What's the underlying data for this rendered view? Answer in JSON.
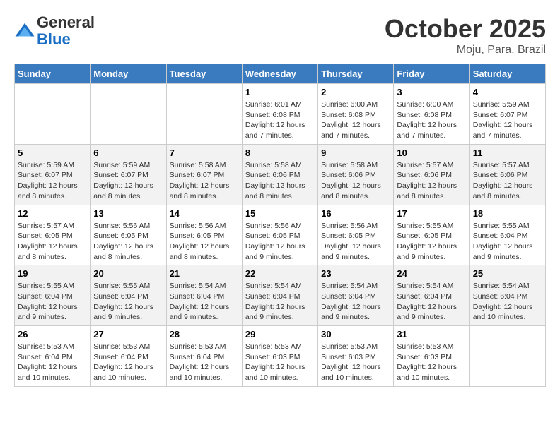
{
  "header": {
    "logo_line1": "General",
    "logo_line2": "Blue",
    "month_title": "October 2025",
    "location": "Moju, Para, Brazil"
  },
  "days_of_week": [
    "Sunday",
    "Monday",
    "Tuesday",
    "Wednesday",
    "Thursday",
    "Friday",
    "Saturday"
  ],
  "weeks": [
    [
      {
        "day": "",
        "info": ""
      },
      {
        "day": "",
        "info": ""
      },
      {
        "day": "",
        "info": ""
      },
      {
        "day": "1",
        "info": "Sunrise: 6:01 AM\nSunset: 6:08 PM\nDaylight: 12 hours and 7 minutes."
      },
      {
        "day": "2",
        "info": "Sunrise: 6:00 AM\nSunset: 6:08 PM\nDaylight: 12 hours and 7 minutes."
      },
      {
        "day": "3",
        "info": "Sunrise: 6:00 AM\nSunset: 6:08 PM\nDaylight: 12 hours and 7 minutes."
      },
      {
        "day": "4",
        "info": "Sunrise: 5:59 AM\nSunset: 6:07 PM\nDaylight: 12 hours and 7 minutes."
      }
    ],
    [
      {
        "day": "5",
        "info": "Sunrise: 5:59 AM\nSunset: 6:07 PM\nDaylight: 12 hours and 8 minutes."
      },
      {
        "day": "6",
        "info": "Sunrise: 5:59 AM\nSunset: 6:07 PM\nDaylight: 12 hours and 8 minutes."
      },
      {
        "day": "7",
        "info": "Sunrise: 5:58 AM\nSunset: 6:07 PM\nDaylight: 12 hours and 8 minutes."
      },
      {
        "day": "8",
        "info": "Sunrise: 5:58 AM\nSunset: 6:06 PM\nDaylight: 12 hours and 8 minutes."
      },
      {
        "day": "9",
        "info": "Sunrise: 5:58 AM\nSunset: 6:06 PM\nDaylight: 12 hours and 8 minutes."
      },
      {
        "day": "10",
        "info": "Sunrise: 5:57 AM\nSunset: 6:06 PM\nDaylight: 12 hours and 8 minutes."
      },
      {
        "day": "11",
        "info": "Sunrise: 5:57 AM\nSunset: 6:06 PM\nDaylight: 12 hours and 8 minutes."
      }
    ],
    [
      {
        "day": "12",
        "info": "Sunrise: 5:57 AM\nSunset: 6:05 PM\nDaylight: 12 hours and 8 minutes."
      },
      {
        "day": "13",
        "info": "Sunrise: 5:56 AM\nSunset: 6:05 PM\nDaylight: 12 hours and 8 minutes."
      },
      {
        "day": "14",
        "info": "Sunrise: 5:56 AM\nSunset: 6:05 PM\nDaylight: 12 hours and 8 minutes."
      },
      {
        "day": "15",
        "info": "Sunrise: 5:56 AM\nSunset: 6:05 PM\nDaylight: 12 hours and 9 minutes."
      },
      {
        "day": "16",
        "info": "Sunrise: 5:56 AM\nSunset: 6:05 PM\nDaylight: 12 hours and 9 minutes."
      },
      {
        "day": "17",
        "info": "Sunrise: 5:55 AM\nSunset: 6:05 PM\nDaylight: 12 hours and 9 minutes."
      },
      {
        "day": "18",
        "info": "Sunrise: 5:55 AM\nSunset: 6:04 PM\nDaylight: 12 hours and 9 minutes."
      }
    ],
    [
      {
        "day": "19",
        "info": "Sunrise: 5:55 AM\nSunset: 6:04 PM\nDaylight: 12 hours and 9 minutes."
      },
      {
        "day": "20",
        "info": "Sunrise: 5:55 AM\nSunset: 6:04 PM\nDaylight: 12 hours and 9 minutes."
      },
      {
        "day": "21",
        "info": "Sunrise: 5:54 AM\nSunset: 6:04 PM\nDaylight: 12 hours and 9 minutes."
      },
      {
        "day": "22",
        "info": "Sunrise: 5:54 AM\nSunset: 6:04 PM\nDaylight: 12 hours and 9 minutes."
      },
      {
        "day": "23",
        "info": "Sunrise: 5:54 AM\nSunset: 6:04 PM\nDaylight: 12 hours and 9 minutes."
      },
      {
        "day": "24",
        "info": "Sunrise: 5:54 AM\nSunset: 6:04 PM\nDaylight: 12 hours and 9 minutes."
      },
      {
        "day": "25",
        "info": "Sunrise: 5:54 AM\nSunset: 6:04 PM\nDaylight: 12 hours and 10 minutes."
      }
    ],
    [
      {
        "day": "26",
        "info": "Sunrise: 5:53 AM\nSunset: 6:04 PM\nDaylight: 12 hours and 10 minutes."
      },
      {
        "day": "27",
        "info": "Sunrise: 5:53 AM\nSunset: 6:04 PM\nDaylight: 12 hours and 10 minutes."
      },
      {
        "day": "28",
        "info": "Sunrise: 5:53 AM\nSunset: 6:04 PM\nDaylight: 12 hours and 10 minutes."
      },
      {
        "day": "29",
        "info": "Sunrise: 5:53 AM\nSunset: 6:03 PM\nDaylight: 12 hours and 10 minutes."
      },
      {
        "day": "30",
        "info": "Sunrise: 5:53 AM\nSunset: 6:03 PM\nDaylight: 12 hours and 10 minutes."
      },
      {
        "day": "31",
        "info": "Sunrise: 5:53 AM\nSunset: 6:03 PM\nDaylight: 12 hours and 10 minutes."
      },
      {
        "day": "",
        "info": ""
      }
    ]
  ]
}
